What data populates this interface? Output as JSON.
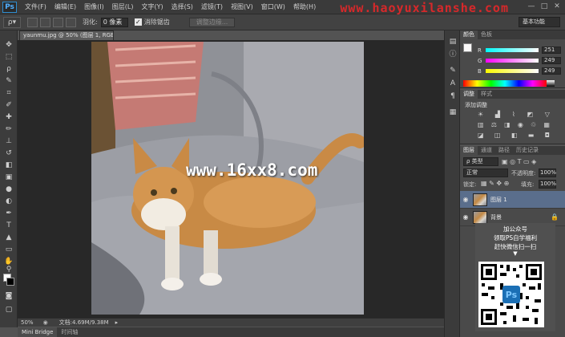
{
  "menubar": {
    "logo": "Ps",
    "items": [
      "文件(F)",
      "编辑(E)",
      "图像(I)",
      "图层(L)",
      "文字(Y)",
      "选择(S)",
      "滤镜(T)",
      "视图(V)",
      "窗口(W)",
      "帮助(H)"
    ],
    "watermark": "www.haoyuxilanshe.com",
    "window_controls": [
      "—",
      "□",
      "✕"
    ]
  },
  "options": {
    "feather_label": "羽化:",
    "feather_value": "0 像素",
    "antialias_label": "消除锯齿",
    "refine_edge_label": "调整边缘...",
    "workspace": "基本功能"
  },
  "document": {
    "tab_title": "yaunmu.jpg @ 50% (图层 1, RGB/8) *",
    "center_watermark": "www.16xx8.com"
  },
  "status": {
    "zoom": "50%",
    "doc_info": "文档:4.69M/9.38M"
  },
  "bottom_tabs": [
    "Mini Bridge",
    "时间轴"
  ],
  "color_panel": {
    "tabs": [
      "颜色",
      "色板"
    ],
    "channels": [
      {
        "label": "R",
        "value": "251"
      },
      {
        "label": "G",
        "value": "249"
      },
      {
        "label": "B",
        "value": "249"
      }
    ]
  },
  "adjustments_panel": {
    "tabs": [
      "调整",
      "样式"
    ],
    "title": "添加调整"
  },
  "layers_panel": {
    "tabs": [
      "图层",
      "通道",
      "路径",
      "历史记录"
    ],
    "filter_label": "ρ 类型",
    "blend_mode": "正常",
    "opacity_label": "不透明度:",
    "opacity_value": "100%",
    "lock_label": "锁定:",
    "fill_label": "填充:",
    "fill_value": "100%",
    "layers": [
      {
        "name": "图层 1",
        "selected": true
      },
      {
        "name": "背景",
        "selected": false
      }
    ]
  },
  "promo": {
    "lines": [
      "加公众号",
      "领取PS自学福利",
      "赶快微信扫一扫"
    ],
    "arrow": "▼",
    "qr_badge": "Ps"
  },
  "colors": {
    "accent": "#2d8ccf",
    "watermark_red": "#e0282a",
    "layer_selected": "#5a6e8c"
  }
}
